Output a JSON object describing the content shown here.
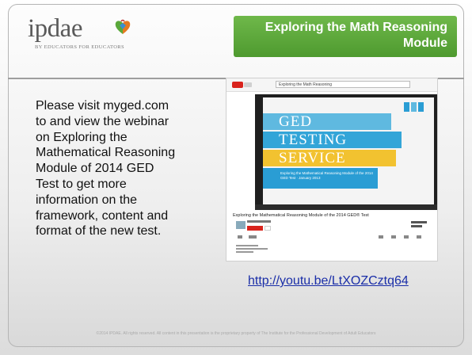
{
  "logo": {
    "text": "ipdae",
    "tagline": "BY EDUCATORS FOR EDUCATORS"
  },
  "title": {
    "line1": "Exploring the Math Reasoning",
    "line2": "Module"
  },
  "body": {
    "lines": [
      "Please visit myged.com",
      "to and view the webinar",
      "on Exploring the",
      "Mathematical Reasoning",
      "Module of 2014 GED",
      "Test to get more",
      "information on the",
      "framework, content and",
      "format of the new test."
    ]
  },
  "video": {
    "search_text": "Exploring the Math Reasoning",
    "slide_lines": [
      "GED",
      "TESTING",
      "SERVICE"
    ],
    "slide_caption": "Exploring the Mathematical Reasoning Module of the 2014 GED Test · January 2013",
    "video_title": "Exploring the Mathematical Reasoning Module of the 2014 GED® Test"
  },
  "link": "http://youtu.be/LtXOZCztq64",
  "footer": "©2014 IPDAE. All rights reserved. All content in this presentation is the proprietary property of The Institute for the Professional Development of Adult Educators",
  "colors": {
    "title_green": "#5aa83a",
    "link_blue": "#1a2ea8",
    "ribbon_blue": "#33a5d8",
    "ribbon_yellow": "#f2c230"
  }
}
